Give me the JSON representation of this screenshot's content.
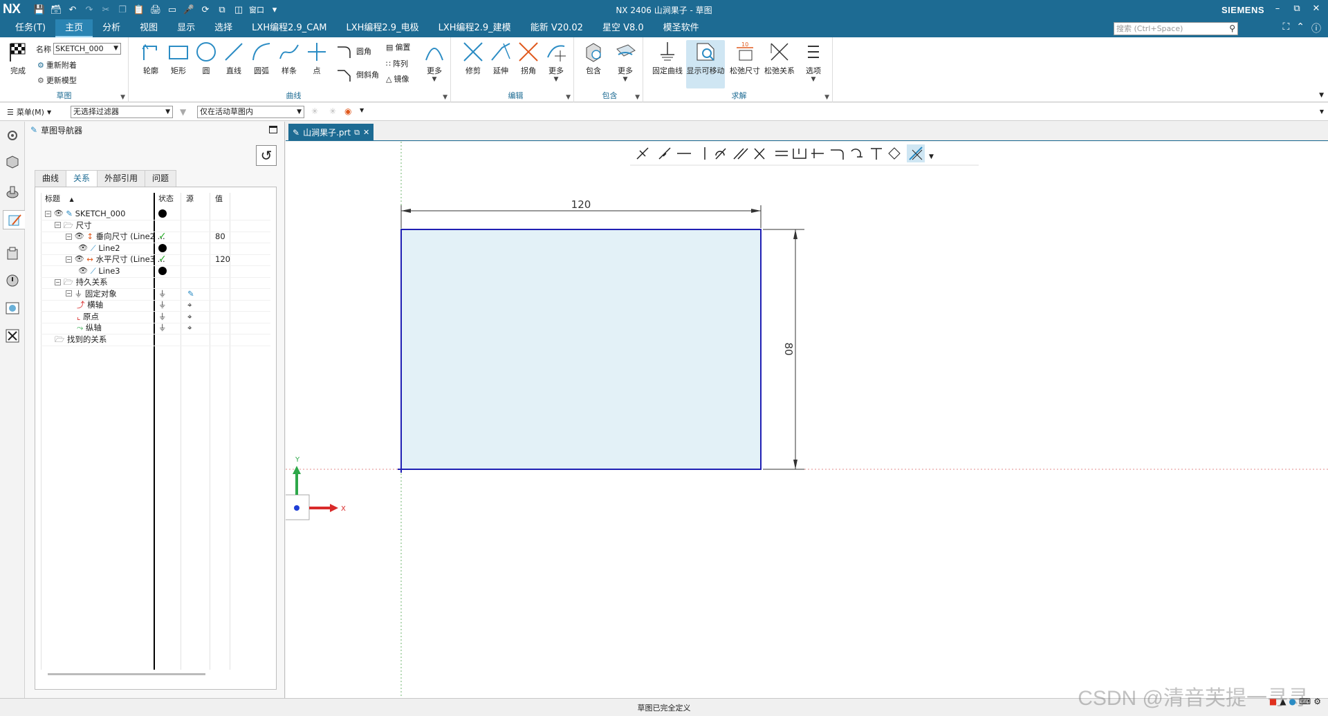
{
  "app": {
    "logo": "NX",
    "title": "NX 2406 山涧果子 - 草图",
    "brand": "SIEMENS",
    "window_menu_label": "窗口"
  },
  "menubar": {
    "tabs": [
      "任务(T)",
      "主页",
      "分析",
      "视图",
      "显示",
      "选择",
      "LXH编程2.9_CAM",
      "LXH编程2.9_电极",
      "LXH编程2.9_建模",
      "能新 V20.02",
      "星空 V8.0",
      "模圣软件"
    ],
    "active_tab": "主页",
    "search_placeholder": "搜索 (Ctrl+Space)"
  },
  "ribbon": {
    "sketch_group": {
      "title": "草图",
      "finish_label": "完成",
      "name_label": "名称",
      "name_value": "SKETCH_000",
      "reattach_label": "重新附着",
      "update_model_label": "更新模型"
    },
    "curve_group": {
      "title": "曲线",
      "buttons": [
        "轮廓",
        "矩形",
        "圆",
        "直线",
        "圆弧",
        "样条",
        "点"
      ],
      "fillet_label": "圆角",
      "chamfer_label": "倒斜角",
      "offset_label": "偏置",
      "pattern_label": "阵列",
      "mirror_label": "镜像",
      "more_label": "更多"
    },
    "edit_group": {
      "title": "编辑",
      "buttons": [
        "修剪",
        "延伸",
        "拐角",
        "更多"
      ]
    },
    "include_group": {
      "title": "包含",
      "buttons": [
        "包含",
        "更多"
      ]
    },
    "solve_group": {
      "title": "求解",
      "buttons": [
        "固定曲线",
        "显示可移动",
        "松弛尺寸",
        "松弛关系",
        "选项"
      ]
    }
  },
  "selection_bar": {
    "menu_label": "菜单(M)",
    "filter_value": "无选择过滤器",
    "scope_value": "仅在活动草图内"
  },
  "navigator": {
    "title": "草图导航器",
    "tabs": [
      "曲线",
      "关系",
      "外部引用",
      "问题"
    ],
    "active_tab": "关系",
    "columns": [
      "标题",
      "状态",
      "源",
      "值"
    ],
    "rows": [
      {
        "label": "SKETCH_000",
        "status": "dot",
        "source": "",
        "value": ""
      },
      {
        "label": "尺寸",
        "status": "",
        "source": "",
        "value": ""
      },
      {
        "label": "垂向尺寸 (Line2 ...",
        "status": "check",
        "source": "",
        "value": "80"
      },
      {
        "label": "Line2",
        "status": "dot",
        "source": "",
        "value": ""
      },
      {
        "label": "水平尺寸 (Line3 ...",
        "status": "check",
        "source": "",
        "value": "120"
      },
      {
        "label": "Line3",
        "status": "dot",
        "source": "",
        "value": ""
      },
      {
        "label": "持久关系",
        "status": "",
        "source": "",
        "value": ""
      },
      {
        "label": "固定对象",
        "status": "fixed",
        "source": "sketch",
        "value": ""
      },
      {
        "label": "横轴",
        "status": "fixed",
        "source": "target",
        "value": ""
      },
      {
        "label": "原点",
        "status": "fixed",
        "source": "target",
        "value": ""
      },
      {
        "label": "纵轴",
        "status": "fixed",
        "source": "target",
        "value": ""
      },
      {
        "label": "找到的关系",
        "status": "",
        "source": "",
        "value": ""
      }
    ]
  },
  "graphics": {
    "tab_label": "山涧果子.prt",
    "dim_horizontal": "120",
    "dim_vertical": "80",
    "axis_x": "X",
    "axis_y": "Y",
    "rect_fill": "#e3f1f7",
    "rect_stroke": "#1f1fb3"
  },
  "status": {
    "message": "草图已完全定义",
    "watermark": "CSDN @清音芙提一寻寻"
  }
}
